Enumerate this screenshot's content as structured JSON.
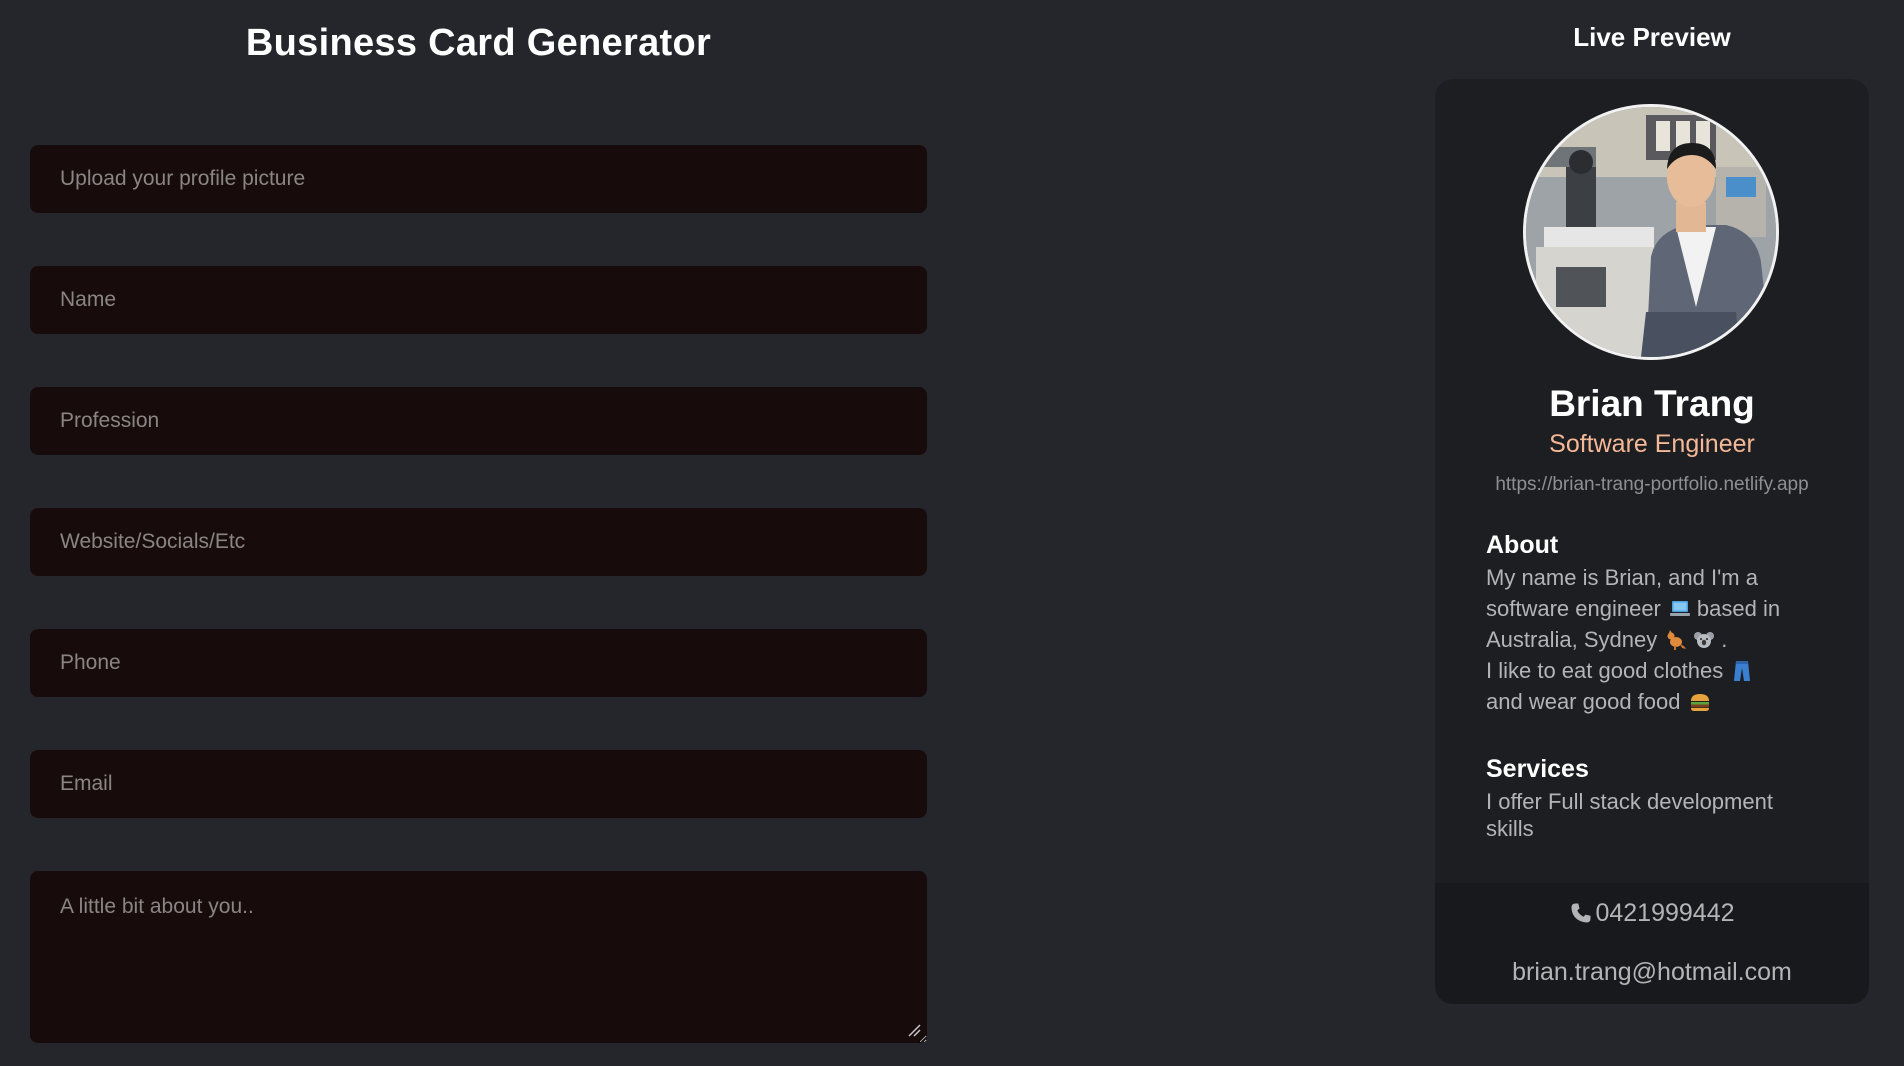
{
  "header": {
    "title": "Business Card Generator"
  },
  "form": {
    "profile_picture": {
      "placeholder": "Upload your profile picture",
      "value": ""
    },
    "name": {
      "placeholder": "Name",
      "value": ""
    },
    "profession": {
      "placeholder": "Profession",
      "value": ""
    },
    "website": {
      "placeholder": "Website/Socials/Etc",
      "value": ""
    },
    "phone": {
      "placeholder": "Phone",
      "value": ""
    },
    "email": {
      "placeholder": "Email",
      "value": ""
    },
    "about": {
      "placeholder": "A little bit about you..",
      "value": ""
    }
  },
  "preview": {
    "title": "Live Preview",
    "name": "Brian Trang",
    "profession": "Software Engineer",
    "website": "https://brian-trang-portfolio.netlify.app",
    "about": {
      "heading": "About",
      "line1": "My name is Brian, and I'm a",
      "line2a": "software engineer",
      "line2b": "based in",
      "line3a": "Australia, Sydney",
      "line3b": ".",
      "line4": "I like to eat good clothes",
      "line5": "and wear good food",
      "emojis": [
        "laptop-icon",
        "kangaroo-icon",
        "koala-icon",
        "jeans-icon",
        "burger-icon"
      ]
    },
    "services": {
      "heading": "Services",
      "text": "I offer Full stack development skills"
    },
    "phone": "0421999442",
    "email": "brian.trang@hotmail.com"
  },
  "colors": {
    "background": "#24262c",
    "input_background": "#180b0b",
    "card_background": "#1d1e22",
    "profession_accent": "#f5b896"
  }
}
